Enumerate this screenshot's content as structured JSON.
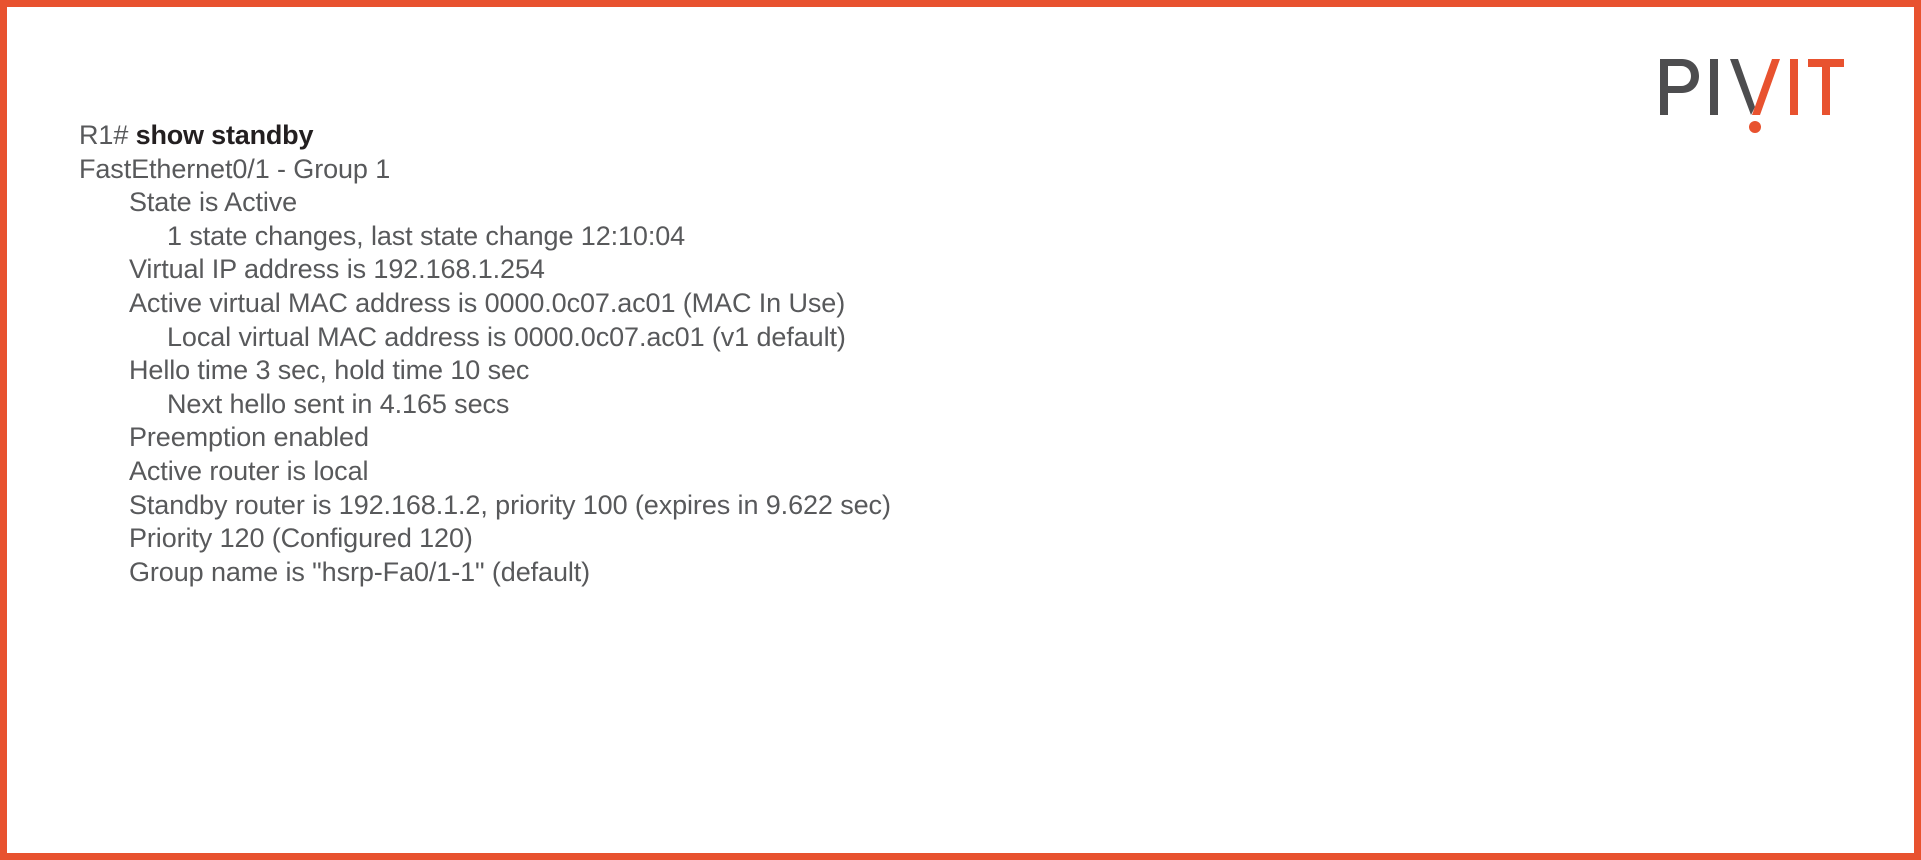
{
  "colors": {
    "border": "#E8522F",
    "accent_orange": "#E8522F",
    "logo_dark": "#4D4D4F",
    "text_gray": "#58595B",
    "command_black": "#231F20",
    "background": "#FFFFFF"
  },
  "logo": {
    "name": "PIVIT",
    "part_dark": "PIV",
    "part_orange": "IT",
    "mark": "exclamation-dot"
  },
  "terminal": {
    "prompt": "R1#",
    "command": "show standby",
    "lines": [
      {
        "indent": 0,
        "text": "FastEthernet0/1 - Group 1"
      },
      {
        "indent": 1,
        "text": "State is Active"
      },
      {
        "indent": 2,
        "text": "1 state changes, last state change 12:10:04"
      },
      {
        "indent": 1,
        "text": "Virtual IP address is 192.168.1.254"
      },
      {
        "indent": 1,
        "text": "Active virtual MAC address is 0000.0c07.ac01 (MAC In Use)"
      },
      {
        "indent": 2,
        "text": "Local virtual MAC address is 0000.0c07.ac01 (v1 default)"
      },
      {
        "indent": 1,
        "text": "Hello time 3 sec, hold time 10 sec"
      },
      {
        "indent": 2,
        "text": "Next hello sent in 4.165 secs"
      },
      {
        "indent": 1,
        "text": "Preemption enabled"
      },
      {
        "indent": 1,
        "text": "Active router is local"
      },
      {
        "indent": 1,
        "text": "Standby router is 192.168.1.2, priority 100 (expires in 9.622 sec)"
      },
      {
        "indent": 1,
        "text": "Priority 120 (Configured 120)"
      },
      {
        "indent": 1,
        "text": "Group name is \"hsrp-Fa0/1-1\" (default)"
      }
    ]
  }
}
